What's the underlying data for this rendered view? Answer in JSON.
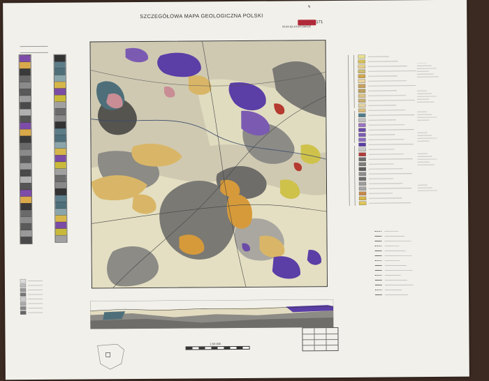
{
  "header": {
    "title": "SZCZEGÓŁOWA MAPA GEOLOGICZNA POLSKI",
    "sheet_number": "171",
    "sheet_code": "M-34-62-A  KATOWICE"
  },
  "scale": {
    "label": "1:50 000"
  },
  "map_colors": {
    "base": "#cfc9b2",
    "light": "#e4dfc2",
    "tan": "#d9b667",
    "orange": "#d69a3a",
    "gray_dark": "#6e6d69",
    "gray_mid": "#8c8b86",
    "gray_light": "#a9a7a0",
    "purple": "#5b3ea6",
    "lilac": "#8a6cc1",
    "pink": "#c98d95",
    "red": "#b53a2f",
    "teal": "#4e6f7a",
    "yellow": "#cfc24b"
  },
  "left_column_colors": [
    "#7d4ca8",
    "#d9a94a",
    "#3a3a3a",
    "#6a6a6a",
    "#8a8a8a",
    "#5a5a5a",
    "#9a9a9a",
    "#4a4a4a",
    "#b0b0b0",
    "#555"
  ],
  "mid_column_colors": [
    "#333",
    "#5c7c88",
    "#4e6f7a",
    "#8aa5aa",
    "#d6b64a",
    "#7b4ca5",
    "#c9b93a",
    "#a0a0a0",
    "#6b6b6b",
    "#888"
  ],
  "legend_colors": [
    "#e8e090",
    "#d7c15a",
    "#e5cf8a",
    "#cdbb72",
    "#d2a64c",
    "#e7d49f",
    "#c9a25c",
    "#bca15f",
    "#dcc285",
    "#c8b070",
    "#e3d3a3",
    "#d9bd7a",
    "#4e7d8a",
    "#bfbfbf",
    "#9a73c3",
    "#6a4ca8",
    "#7b5bb2",
    "#8c6dc0",
    "#5b3ea6",
    "#c7c7c7",
    "#b33a3a",
    "#6b6b6b",
    "#7d7d7d",
    "#5e5e5e",
    "#8e8e8e",
    "#6f6f6f",
    "#9d9d9d",
    "#a6a6a6",
    "#c78a4a",
    "#d6b64a",
    "#e0c65a"
  ],
  "symbol_legend_count": 14
}
